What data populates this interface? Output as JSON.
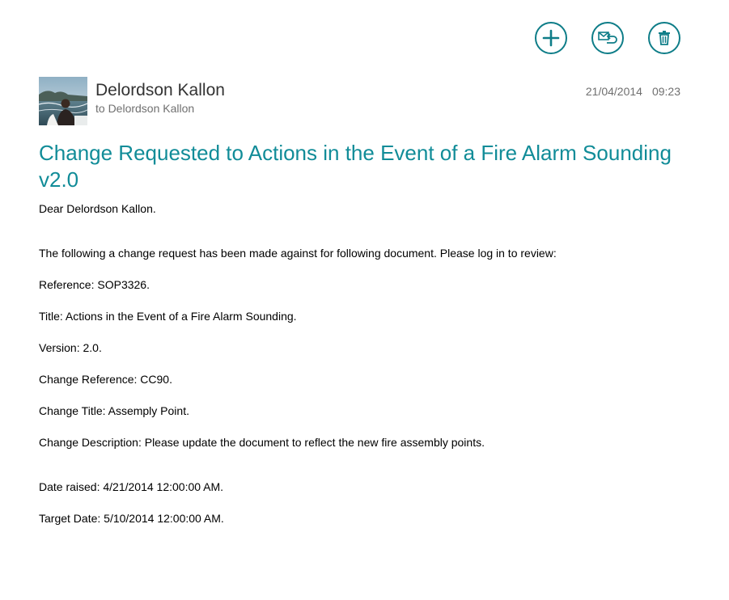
{
  "toolbar": {
    "new_icon": "plus-icon",
    "reply_icon": "reply-icon",
    "delete_icon": "trash-icon",
    "accent_color": "#0e7d88"
  },
  "message": {
    "sender_name": "Delordson Kallon",
    "recipient_line": "to Delordson Kallon",
    "date": "21/04/2014",
    "time": "09:23",
    "subject": "Change Requested to Actions in the Event of a Fire Alarm Sounding v2.0",
    "subject_color": "#118c98",
    "body": {
      "greeting": "Dear Delordson Kallon.",
      "intro": "The following a change request has been made against for following document. Please log in to review:",
      "reference": "Reference: SOP3326.",
      "title": "Title: Actions in the Event of a Fire Alarm Sounding.",
      "version": "Version: 2.0.",
      "change_reference": "Change Reference: CC90.",
      "change_title": "Change Title: Assemply Point.",
      "change_description": "Change Description: Please update the document to reflect the new fire assembly points.",
      "date_raised": "Date raised: 4/21/2014 12:00:00 AM.",
      "target_date": "Target Date: 5/10/2014 12:00:00 AM."
    }
  }
}
